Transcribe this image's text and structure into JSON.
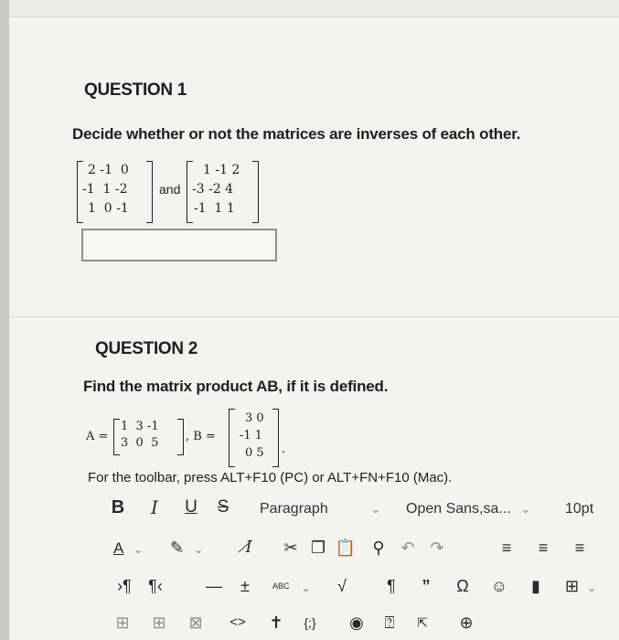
{
  "question1": {
    "title": "QUESTION 1",
    "prompt": "Decide whether or not the matrices are inverses of each other.",
    "matrix_left_rows": [
      "2 -1  0",
      "-1  1 -2",
      "1  0 -1"
    ],
    "connector": "and",
    "matrix_right_rows": [
      "1 -1 2",
      "-3 -2 4",
      "-1  1 1"
    ]
  },
  "question2": {
    "title": "QUESTION 2",
    "prompt": "Find the matrix product AB, if it is defined.",
    "a_label": "A =",
    "matrix_a_rows": [
      "1  3 -1",
      "3  0  5"
    ],
    "b_label": ", B =",
    "matrix_b_rows": [
      "3 0",
      "-1 1",
      "0 5"
    ],
    "period": ".",
    "toolbar_hint": "For the toolbar, press ALT+F10 (PC) or ALT+FN+F10 (Mac)."
  },
  "toolbar": {
    "bold": "B",
    "italic": "I",
    "underline": "U",
    "strike": "S",
    "format_select": "Paragraph",
    "font_select": "Open Sans,sa...",
    "size_select": "10pt",
    "font_color": "A",
    "spellcheck_label": "ABC"
  },
  "colors": {
    "accent_blue": "#2b6fc9",
    "page_bg": "#f3f3f1"
  }
}
